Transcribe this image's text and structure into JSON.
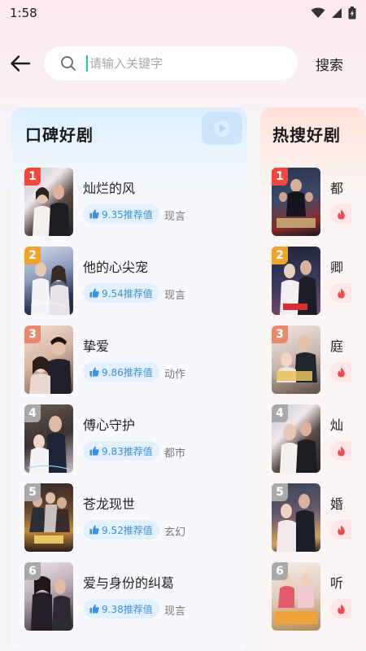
{
  "status": {
    "time": "1:58"
  },
  "header": {
    "search_placeholder": "请输入关键字",
    "search_button": "搜索"
  },
  "sections": [
    {
      "title": "口碑好剧",
      "items": [
        {
          "rank": "1",
          "title": "灿烂的风",
          "score": "9.35推荐值",
          "genre": "现言"
        },
        {
          "rank": "2",
          "title": "他的心尖宠",
          "score": "9.54推荐值",
          "genre": "现言"
        },
        {
          "rank": "3",
          "title": "挚爱",
          "score": "9.86推荐值",
          "genre": "动作"
        },
        {
          "rank": "4",
          "title": "傅心守护",
          "score": "9.83推荐值",
          "genre": "都市"
        },
        {
          "rank": "5",
          "title": "苍龙现世",
          "score": "9.52推荐值",
          "genre": "玄幻"
        },
        {
          "rank": "6",
          "title": "爱与身份的纠葛",
          "score": "9.38推荐值",
          "genre": "现言"
        }
      ]
    },
    {
      "title": "热搜好剧",
      "items": [
        {
          "rank": "1",
          "title": "都"
        },
        {
          "rank": "2",
          "title": "卿"
        },
        {
          "rank": "3",
          "title": "庭"
        },
        {
          "rank": "4",
          "title": "灿"
        },
        {
          "rank": "5",
          "title": "婚"
        },
        {
          "rank": "6",
          "title": "听"
        }
      ]
    }
  ],
  "colors": {
    "rank_1": "#f2483a",
    "rank_2": "#f3a22a",
    "rank_3": "#e88a6a",
    "rank_other": "#a9a9a9",
    "score_text": "#3d8fe0",
    "score_bg": "#e3f1ff",
    "fire": "#f04a4a"
  },
  "icons": [
    "back-arrow-icon",
    "search-icon",
    "thumbs-up-icon",
    "fire-icon",
    "wifi-icon",
    "signal-icon",
    "battery-icon"
  ]
}
